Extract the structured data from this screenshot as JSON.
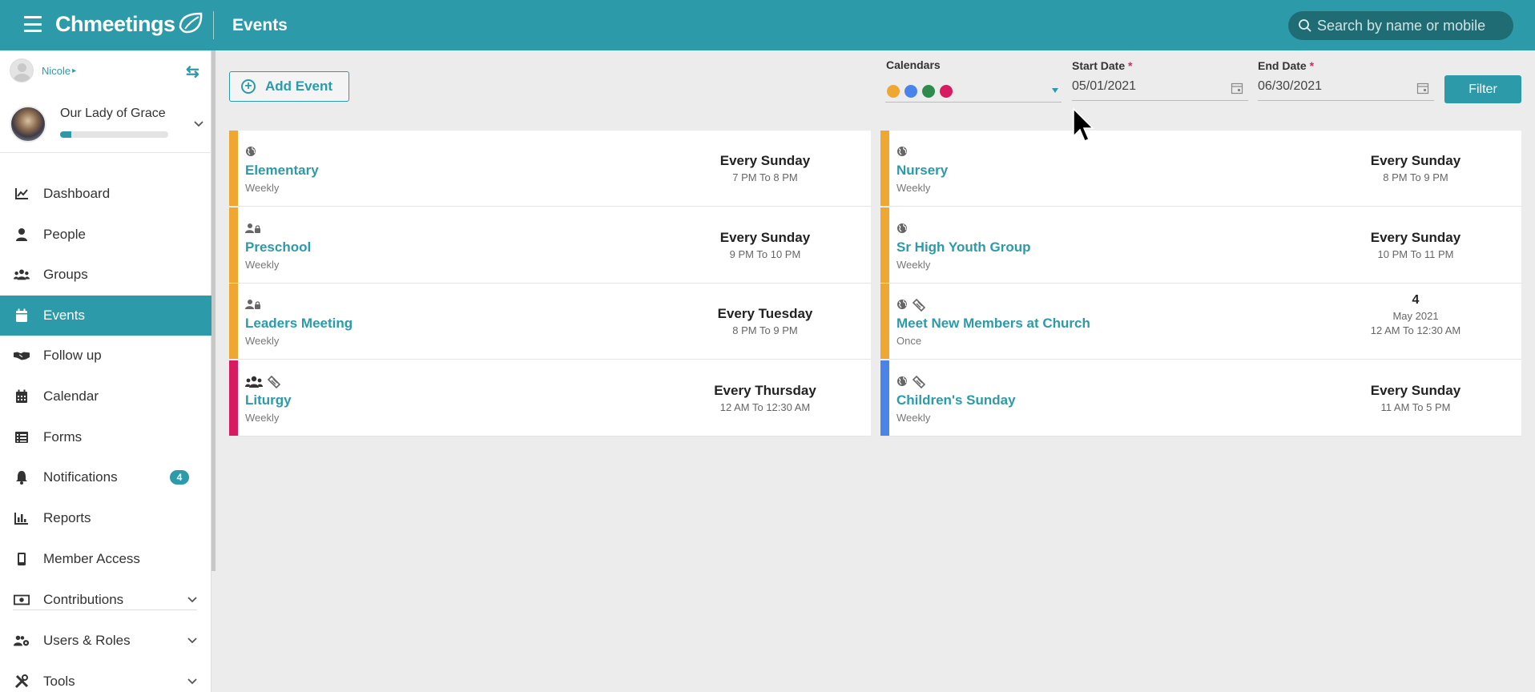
{
  "app": {
    "brand": "Chmeetings",
    "page_title": "Events",
    "search_placeholder": "Search by name or mobile"
  },
  "sidebar": {
    "user_name": "Nicole",
    "church_name": "Our Lady of Grace",
    "church_progress": 0.1,
    "items": [
      {
        "label": "Dashboard",
        "icon": "chart-line-icon"
      },
      {
        "label": "People",
        "icon": "person-icon"
      },
      {
        "label": "Groups",
        "icon": "users-icon"
      },
      {
        "label": "Events",
        "icon": "calendar-day-icon",
        "active": true
      },
      {
        "label": "Follow up",
        "icon": "handshake-icon"
      },
      {
        "label": "Calendar",
        "icon": "calendar-grid-icon"
      },
      {
        "label": "Forms",
        "icon": "list-icon"
      },
      {
        "label": "Notifications",
        "icon": "bell-icon",
        "badge": "4"
      },
      {
        "label": "Reports",
        "icon": "bar-chart-icon"
      },
      {
        "label": "Member Access",
        "icon": "mobile-icon"
      },
      {
        "label": "Contributions",
        "icon": "money-icon",
        "expandable": true
      },
      {
        "label": "Users & Roles",
        "icon": "users-cog-icon",
        "expandable": true
      },
      {
        "label": "Tools",
        "icon": "tools-icon",
        "expandable": true
      }
    ]
  },
  "toolbar": {
    "add_event_label": "Add Event",
    "calendars_label": "Calendars",
    "calendar_colors": [
      "#f0a732",
      "#4b84e8",
      "#2e8b4e",
      "#d81b60"
    ],
    "start_date_label": "Start Date",
    "start_date_value": "05/01/2021",
    "end_date_label": "End Date",
    "end_date_value": "06/30/2021",
    "required_mark": "*",
    "filter_label": "Filter"
  },
  "events_left": [
    {
      "name": "Elementary",
      "freq": "Weekly",
      "when": "Every Sunday",
      "time": "7 PM To 8 PM",
      "color": "#f0a732",
      "icons": [
        "globe-icon"
      ]
    },
    {
      "name": "Preschool",
      "freq": "Weekly",
      "when": "Every Sunday",
      "time": "9 PM To 10 PM",
      "color": "#f0a732",
      "icons": [
        "user-lock-icon"
      ]
    },
    {
      "name": "Leaders Meeting",
      "freq": "Weekly",
      "when": "Every Tuesday",
      "time": "8 PM To 9 PM",
      "color": "#f0a732",
      "icons": [
        "user-lock-icon"
      ]
    },
    {
      "name": "Liturgy",
      "freq": "Weekly",
      "when": "Every Thursday",
      "time": "12 AM To 12:30 AM",
      "color": "#d81b60",
      "icons": [
        "users-icon",
        "ticket-icon"
      ]
    }
  ],
  "events_right": [
    {
      "name": "Nursery",
      "freq": "Weekly",
      "when": "Every Sunday",
      "time": "8 PM To 9 PM",
      "color": "#f0a732",
      "icons": [
        "globe-icon"
      ]
    },
    {
      "name": "Sr High Youth Group",
      "freq": "Weekly",
      "when": "Every Sunday",
      "time": "10 PM To 11 PM",
      "color": "#f0a732",
      "icons": [
        "globe-icon"
      ]
    },
    {
      "name": "Meet New Members at Church",
      "freq": "Once",
      "when": "4",
      "month": "May 2021",
      "time": "12 AM To 12:30 AM",
      "color": "#f0a732",
      "icons": [
        "globe-icon",
        "ticket-icon"
      ]
    },
    {
      "name": "Children's Sunday",
      "freq": "Weekly",
      "when": "Every Sunday",
      "time": "11 AM To 5 PM",
      "color": "#4b84e8",
      "icons": [
        "globe-icon",
        "ticket-icon"
      ]
    }
  ]
}
